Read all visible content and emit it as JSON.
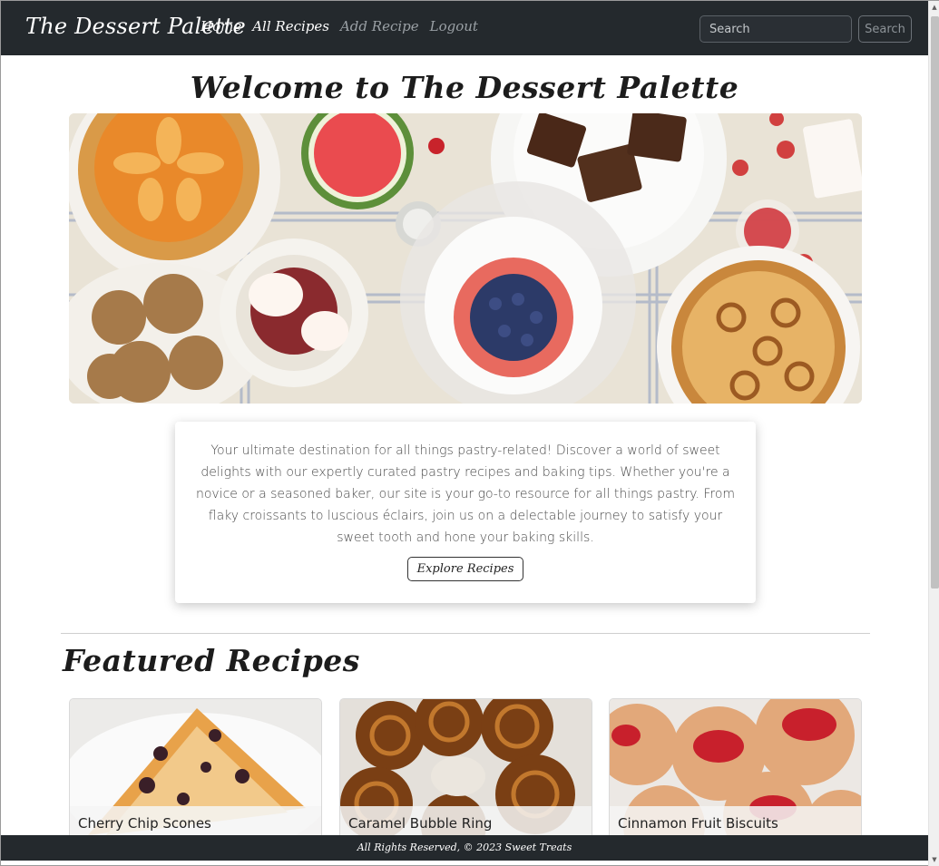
{
  "navbar": {
    "brand": "The Dessert Palette",
    "links": [
      {
        "label": "Home",
        "muted": false
      },
      {
        "label": "All Recipes",
        "muted": false
      },
      {
        "label": "Add Recipe",
        "muted": true
      },
      {
        "label": "Logout",
        "muted": true
      }
    ],
    "search_placeholder": "Search",
    "search_button": "Search"
  },
  "hero": {
    "title": "Welcome to The Dessert Palette"
  },
  "intro": {
    "text": "Your ultimate destination for all things pastry-related! Discover a world of sweet delights with our expertly curated pastry recipes and baking tips. Whether you're a novice or a seasoned baker, our site is your go-to resource for all things pastry. From flaky croissants to luscious éclairs, join us on a delectable journey to satisfy your sweet tooth and hone your baking skills.",
    "button": "Explore Recipes"
  },
  "featured": {
    "title": "Featured Recipes",
    "recipes": [
      {
        "name": "Cherry Chip Scones"
      },
      {
        "name": "Caramel Bubble Ring"
      },
      {
        "name": "Cinnamon Fruit Biscuits"
      }
    ]
  },
  "footer": {
    "text": "All Rights Reserved, © 2023 Sweet Treats"
  },
  "colors": {
    "navbar_bg": "#24292d",
    "footer_bg": "#24292d",
    "muted_link": "#9aa0a5"
  }
}
